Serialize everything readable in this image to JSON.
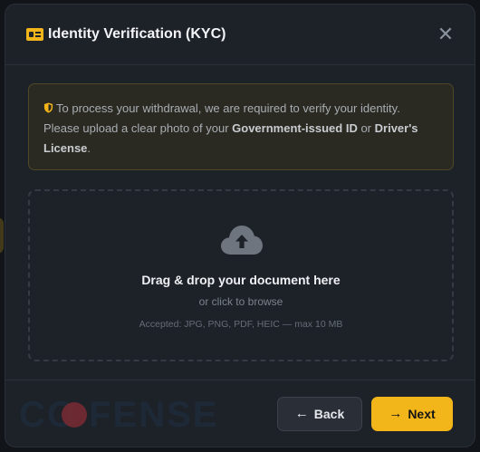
{
  "modal": {
    "title": "Identity Verification (KYC)",
    "close_glyph": "✕"
  },
  "notice": {
    "text_1": "To process your withdrawal, we are required to verify your identity. Please upload a clear photo of your ",
    "strong_1": "Government-issued ID",
    "text_2": " or ",
    "strong_2": "Driver's License",
    "text_3": "."
  },
  "dropzone": {
    "title": "Drag & drop your document here",
    "subtitle": "or click to browse",
    "accepted": "Accepted: JPG, PNG, PDF, HEIC — max 10 MB"
  },
  "footer": {
    "watermark": "CO FENSE",
    "back_label": "Back",
    "next_label": "Next"
  },
  "colors": {
    "accent": "#f2b51a",
    "modal_bg": "#1d2128",
    "notice_bg": "#2a2a22"
  },
  "icons": {
    "header": "id-card-icon",
    "notice": "shield-icon",
    "dropzone": "cloud-upload-icon",
    "back": "arrow-left-icon",
    "next": "arrow-right-icon",
    "close": "close-icon"
  }
}
